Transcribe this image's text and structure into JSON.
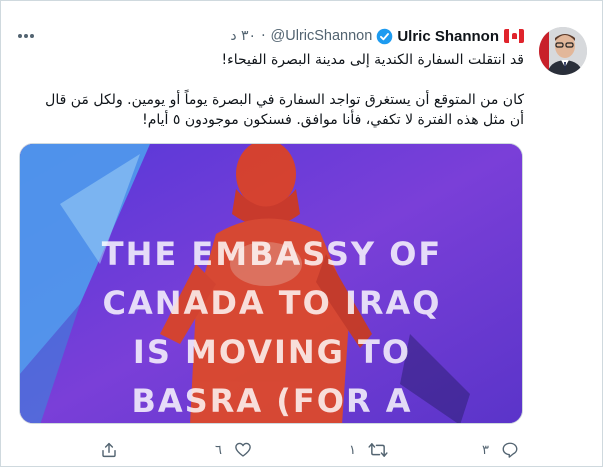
{
  "tweet": {
    "author_name": "Ulric Shannon",
    "handle": "@UlricShannon",
    "time": "٣٠ د",
    "line1": "قد انتقلت السفارة الكندية إلى مدينة البصرة الفيحاء!",
    "line2": "كان من المتوقع أن يستغرق تواجد السفارة في البصرة يوماً أو يومين.  ولكل مَن قال",
    "line3": "أن مثل هذه الفترة لا تكفي، فأنا موافق.  فسنكون موجودون ٥ أيام!",
    "media_caption": "THE EMBASSY OF\nCANADA TO IRAQ\nIS MOVING TO\nBASRA (FOR A\nDAY)!"
  },
  "actions": {
    "reply_count": "٣",
    "retweet_count": "١",
    "like_count": "٦"
  },
  "icons": {
    "flag": "canada-flag-icon",
    "verified": "verified-badge-icon",
    "more": "more-icon",
    "reply": "reply-icon",
    "retweet": "retweet-icon",
    "like": "like-icon",
    "share": "share-icon"
  },
  "colors": {
    "verified": "#1d9bf0",
    "secondary_text": "#536471",
    "media_background": "#6d43d6",
    "statue": "#e0431f"
  }
}
